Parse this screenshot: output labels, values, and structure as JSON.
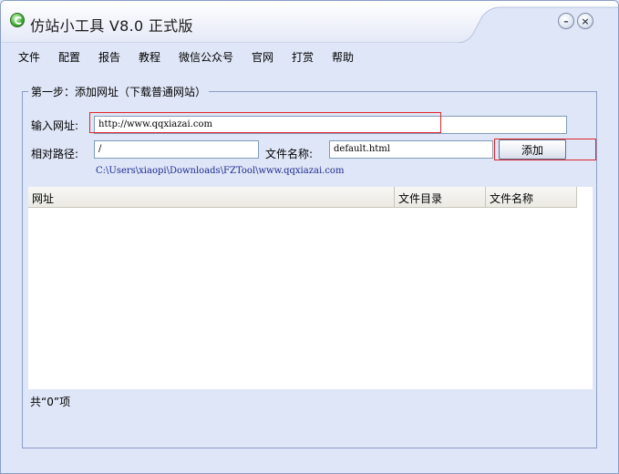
{
  "window": {
    "title": "仿站小工具 V8.0 正式版",
    "minimize_glyph": "–",
    "close_glyph": "×"
  },
  "menu": [
    "文件",
    "配置",
    "报告",
    "教程",
    "微信公众号",
    "官网",
    "打赏",
    "帮助"
  ],
  "step": {
    "legend": "第一步：添加网址（下载普通网站）",
    "url_label": "输入网址:",
    "url_value": "http://www.qqxiazai.com",
    "path_label": "相对路径:",
    "path_value": "/",
    "filename_label": "文件名称:",
    "filename_value": "default.html",
    "add_button": "添加",
    "save_path": "C:\\Users\\xiaopi\\Downloads\\FZTool\\www.qqxiazai.com"
  },
  "table": {
    "columns": [
      "网址",
      "文件目录",
      "文件名称"
    ],
    "rows": []
  },
  "status": {
    "count_text": "共“0”项"
  },
  "colors": {
    "background": "#dfe6f7",
    "highlight_border": "#e0262a",
    "path_text": "#1d2a8f"
  }
}
